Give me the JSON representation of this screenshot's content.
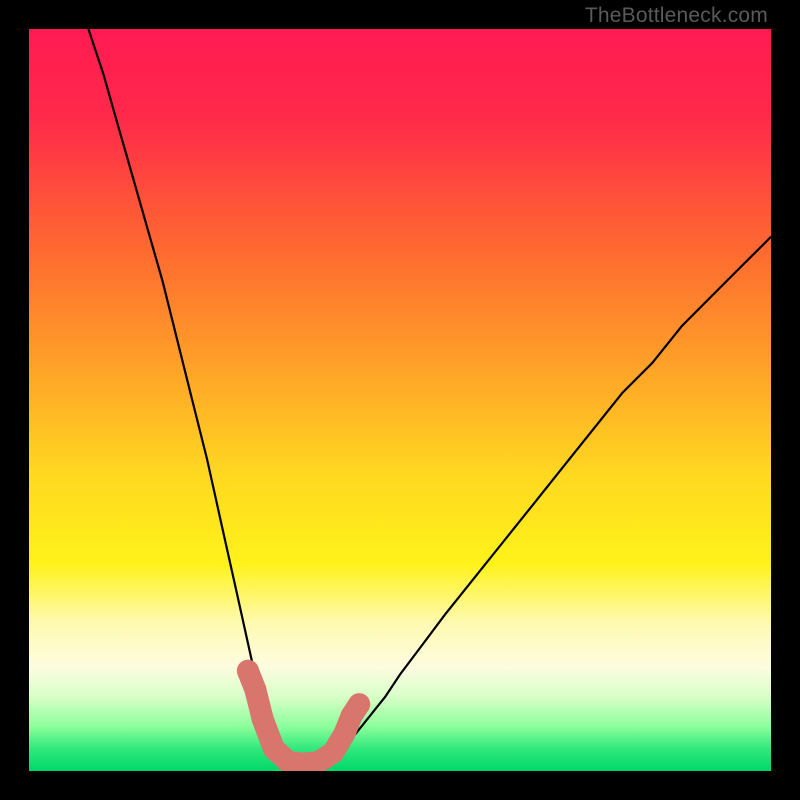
{
  "watermark": "TheBottleneck.com",
  "chart_data": {
    "type": "line",
    "title": "",
    "xlabel": "",
    "ylabel": "",
    "xlim": [
      0,
      100
    ],
    "ylim": [
      0,
      100
    ],
    "gradient_bands": [
      {
        "stop": 0.0,
        "color": "#ff1a52"
      },
      {
        "stop": 0.12,
        "color": "#ff2a4a"
      },
      {
        "stop": 0.3,
        "color": "#ff6a30"
      },
      {
        "stop": 0.45,
        "color": "#ffa028"
      },
      {
        "stop": 0.6,
        "color": "#ffd820"
      },
      {
        "stop": 0.72,
        "color": "#fff21a"
      },
      {
        "stop": 0.8,
        "color": "#fffab0"
      },
      {
        "stop": 0.86,
        "color": "#fcfce0"
      },
      {
        "stop": 0.9,
        "color": "#d8ffc8"
      },
      {
        "stop": 0.94,
        "color": "#8cff9c"
      },
      {
        "stop": 0.97,
        "color": "#30e87c"
      },
      {
        "stop": 1.0,
        "color": "#00d86a"
      }
    ],
    "series": [
      {
        "name": "left-curve",
        "color": "#000000",
        "x": [
          8,
          10,
          12,
          14,
          16,
          18,
          20,
          22,
          24,
          26,
          28,
          30,
          31,
          32,
          33,
          34,
          35
        ],
        "y": [
          100,
          94,
          87,
          80,
          73,
          66,
          58,
          50,
          42,
          33,
          24,
          15,
          10,
          6.5,
          4,
          2.5,
          1.5
        ]
      },
      {
        "name": "right-curve",
        "color": "#000000",
        "x": [
          40,
          42,
          44,
          46,
          48,
          50,
          53,
          56,
          60,
          64,
          68,
          72,
          76,
          80,
          84,
          88,
          92,
          96,
          100
        ],
        "y": [
          1.5,
          3,
          5,
          7.5,
          10,
          13,
          17,
          21,
          26,
          31,
          36,
          41,
          46,
          51,
          55,
          60,
          64,
          68,
          72
        ]
      }
    ],
    "markers": {
      "name": "bottleneck-sausage",
      "color": "#d8766e",
      "points": [
        {
          "x": 29.5,
          "y": 13.5
        },
        {
          "x": 30.5,
          "y": 11
        },
        {
          "x": 31.5,
          "y": 7
        },
        {
          "x": 33,
          "y": 3
        },
        {
          "x": 35,
          "y": 1.2
        },
        {
          "x": 37,
          "y": 1.0
        },
        {
          "x": 39,
          "y": 1.2
        },
        {
          "x": 41,
          "y": 2.5
        },
        {
          "x": 42.5,
          "y": 5
        },
        {
          "x": 43.5,
          "y": 7.5
        },
        {
          "x": 44.5,
          "y": 9
        }
      ]
    }
  }
}
